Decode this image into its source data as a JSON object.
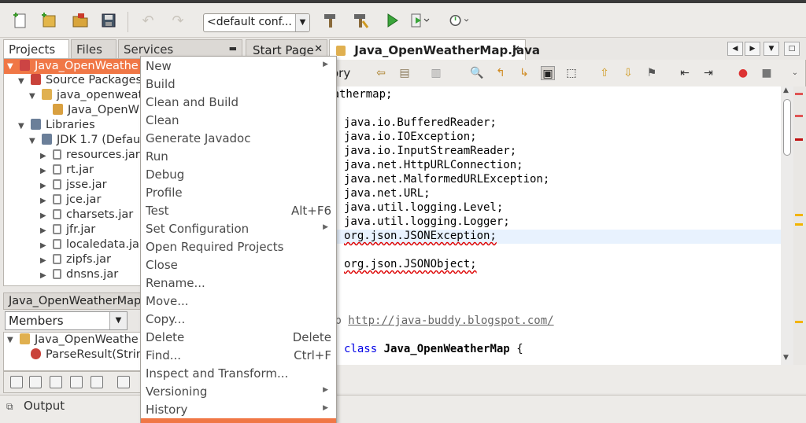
{
  "toolbar": {
    "config_value": "<default conf...",
    "icons": [
      "new-file-icon",
      "new-project-icon",
      "open-project-icon",
      "save-all-icon",
      "undo-icon",
      "redo-icon",
      "build-icon",
      "clean-build-icon",
      "run-icon",
      "debug-icon",
      "profile-icon"
    ]
  },
  "left_tabs": {
    "projects": "Projects",
    "files": "Files",
    "services": "Services"
  },
  "tree": {
    "project": "Java_OpenWeathe",
    "source_packages": "Source Packages",
    "package": "java_openweat",
    "file": "Java_OpenW",
    "libraries": "Libraries",
    "jdk": "JDK 1.7 (Defau",
    "jars": [
      "resources.jar",
      "rt.jar",
      "jsse.jar",
      "jce.jar",
      "charsets.jar",
      "jfr.jar",
      "localedata.ja",
      "zipfs.jar",
      "dnsns.jar"
    ]
  },
  "navigator": {
    "title": "Java_OpenWeatherMap",
    "filter": "Members",
    "class_node": "Java_OpenWeathe",
    "method_node": "ParseResult(Strin"
  },
  "output_label": "Output",
  "editor_tabs": {
    "start_page": "Start Page",
    "file": "Java_OpenWeatherMap.java"
  },
  "editor_toolbar": {
    "history_label": "ory"
  },
  "code_lines": [
    {
      "prefix": "e ",
      "text": "java_openweathermap;"
    },
    {
      "prefix": "",
      "text": ""
    },
    {
      "prefix": "",
      "text": "java.io.BufferedReader;"
    },
    {
      "prefix": "",
      "text": "java.io.IOException;"
    },
    {
      "prefix": "",
      "text": "java.io.InputStreamReader;"
    },
    {
      "prefix": "",
      "text": "java.net.HttpURLConnection;"
    },
    {
      "prefix": "",
      "text": "java.net.MalformedURLException;"
    },
    {
      "prefix": "",
      "text": "java.net.URL;"
    },
    {
      "prefix": "",
      "text": "java.util.logging.Level;"
    },
    {
      "prefix": "",
      "text": "java.util.logging.Logger;"
    },
    {
      "prefix": "",
      "text": "org.json.JSONException;"
    },
    {
      "prefix": "",
      "text": ""
    },
    {
      "prefix": "",
      "text": "org.json.JSONObject;"
    }
  ],
  "code_comment": {
    "prefix": "eb ",
    "url": "http://java-buddy.blogspot.com/"
  },
  "code_class": {
    "keyword": "class",
    "name": "Java_OpenWeatherMap",
    "brace": "{"
  },
  "menu": [
    {
      "label": "New",
      "shortcut": "",
      "submenu": true
    },
    {
      "label": "Build",
      "shortcut": "",
      "submenu": false
    },
    {
      "label": "Clean and Build",
      "shortcut": "",
      "submenu": false
    },
    {
      "label": "Clean",
      "shortcut": "",
      "submenu": false
    },
    {
      "label": "Generate Javadoc",
      "shortcut": "",
      "submenu": false
    },
    {
      "label": "Run",
      "shortcut": "",
      "submenu": false
    },
    {
      "label": "Debug",
      "shortcut": "",
      "submenu": false
    },
    {
      "label": "Profile",
      "shortcut": "",
      "submenu": false
    },
    {
      "label": "Test",
      "shortcut": "Alt+F6",
      "submenu": false
    },
    {
      "label": "Set Configuration",
      "shortcut": "",
      "submenu": true
    },
    {
      "label": "Open Required Projects",
      "shortcut": "",
      "submenu": false
    },
    {
      "label": "Close",
      "shortcut": "",
      "submenu": false
    },
    {
      "label": "Rename...",
      "shortcut": "",
      "submenu": false
    },
    {
      "label": "Move...",
      "shortcut": "",
      "submenu": false
    },
    {
      "label": "Copy...",
      "shortcut": "",
      "submenu": false
    },
    {
      "label": "Delete",
      "shortcut": "Delete",
      "submenu": false
    },
    {
      "label": "Find...",
      "shortcut": "Ctrl+F",
      "submenu": false
    },
    {
      "label": "Inspect and Transform...",
      "shortcut": "",
      "submenu": false
    },
    {
      "label": "Versioning",
      "shortcut": "",
      "submenu": true
    },
    {
      "label": "History",
      "shortcut": "",
      "submenu": true
    },
    {
      "label": "",
      "shortcut": "",
      "submenu": true
    }
  ],
  "colors": {
    "selection": "#f07746",
    "keyword": "#0000e6",
    "highlight_line": "#e8f2fe"
  }
}
